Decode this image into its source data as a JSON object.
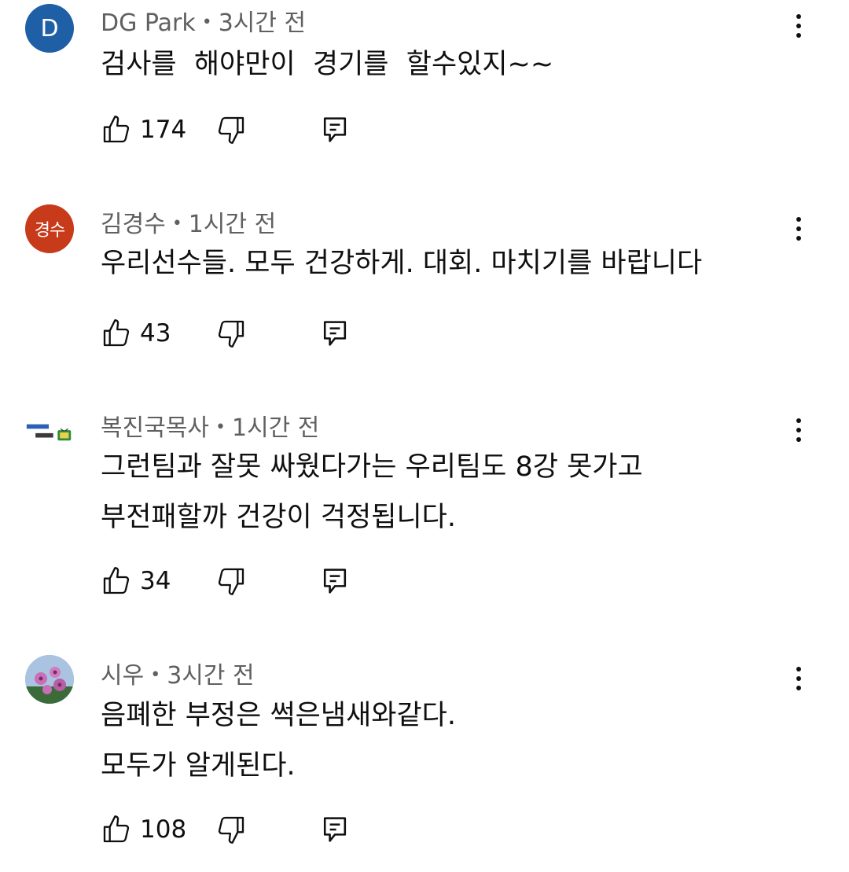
{
  "comments": [
    {
      "avatar_letter": "D",
      "author": "DG Park",
      "time": "3시간 전",
      "text": "검사를  해야만이  경기를  할수있지~~",
      "likes": "174"
    },
    {
      "avatar_letter": "경수",
      "author": "김경수",
      "time": "1시간 전",
      "text": "우리선수들. 모두 건강하게. 대회. 마치기를 바랍니다",
      "likes": "43"
    },
    {
      "avatar_letter": "",
      "author": "복진국목사",
      "time": "1시간 전",
      "text": "그런팀과 잘못 싸웠다가는 우리팀도 8강 못가고\n부전패할까 건강이 걱정됩니다.",
      "likes": "34"
    },
    {
      "avatar_letter": "",
      "author": "시우",
      "time": "3시간 전",
      "text": "음폐한 부정은 썩은냄새와같다.\n모두가 알게된다.",
      "likes": "108"
    }
  ],
  "meta_separator": "•",
  "icons": {
    "like": "thumbs-up-icon",
    "dislike": "thumbs-down-icon",
    "reply": "reply-icon",
    "menu": "more-vert-icon"
  },
  "colors": {
    "avatar_d": "#1f5fa6",
    "avatar_gs": "#c73a1a",
    "meta_text": "#606060",
    "body_text": "#0f0f0f"
  }
}
